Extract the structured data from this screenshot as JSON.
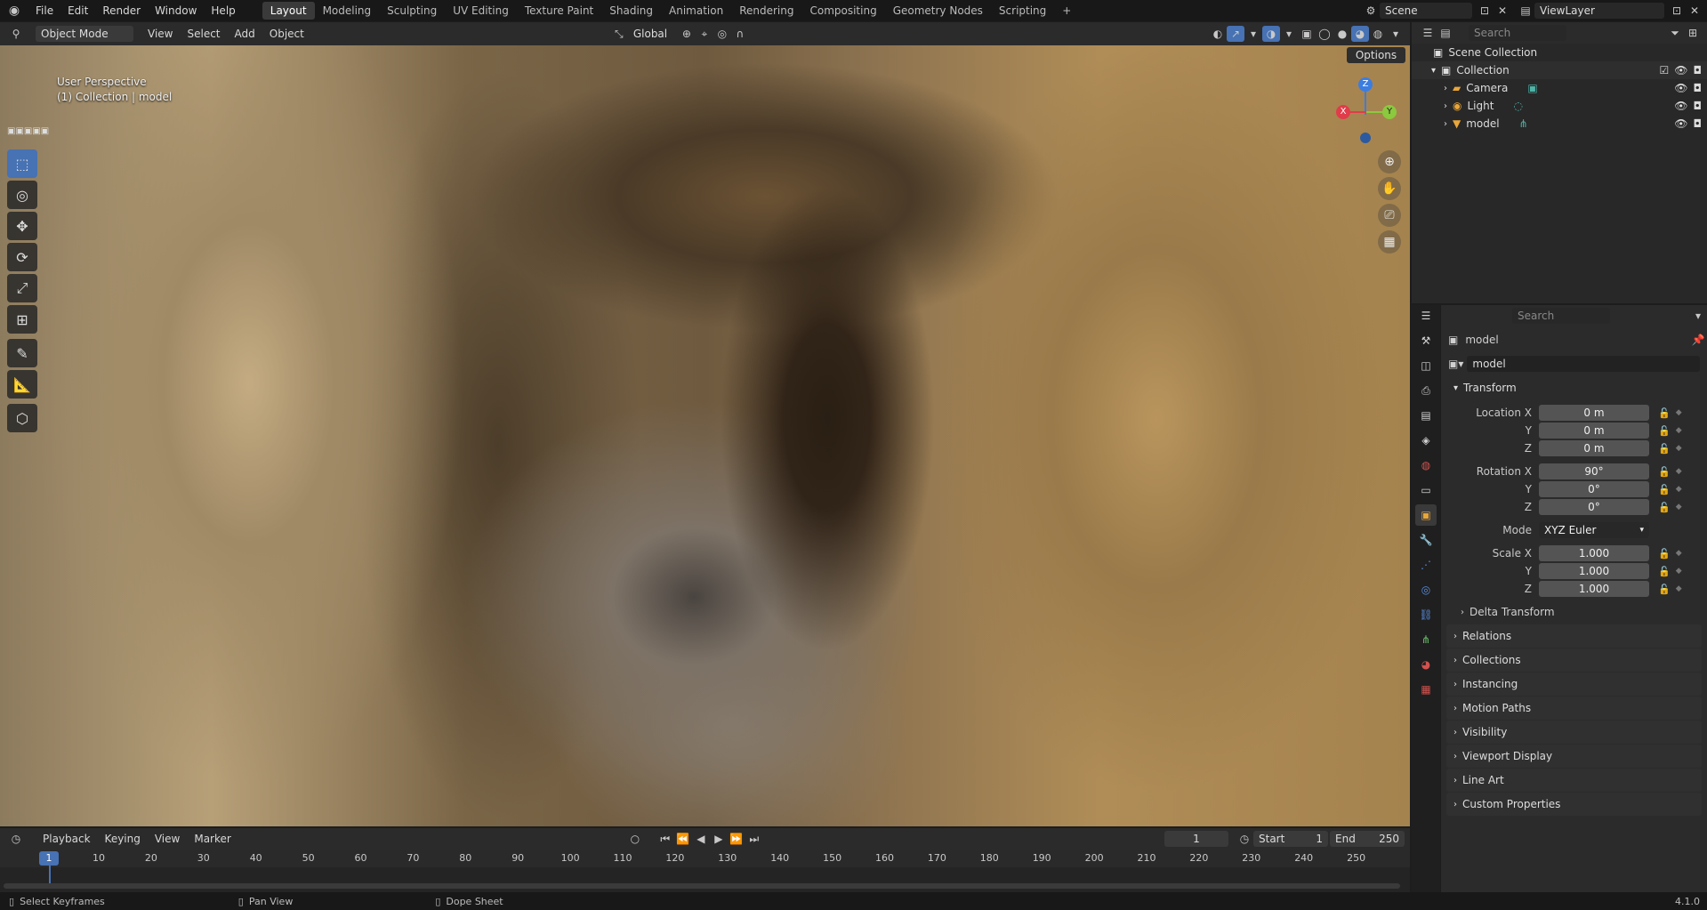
{
  "topbar": {
    "menus": [
      "File",
      "Edit",
      "Render",
      "Window",
      "Help"
    ],
    "workspace_tabs": [
      "Layout",
      "Modeling",
      "Sculpting",
      "UV Editing",
      "Texture Paint",
      "Shading",
      "Animation",
      "Rendering",
      "Compositing",
      "Geometry Nodes",
      "Scripting"
    ],
    "active_workspace": "Layout",
    "add_tab_label": "+",
    "scene_name": "Scene",
    "view_layer": "ViewLayer"
  },
  "viewport_header": {
    "mode": "Object Mode",
    "menus": [
      "View",
      "Select",
      "Add",
      "Object"
    ],
    "orientation": "Global",
    "options_label": "Options"
  },
  "viewport": {
    "perspective_label": "User Perspective",
    "collection_label": "(1) Collection | model",
    "gizmo": {
      "x": "X",
      "y": "Y",
      "z": "Z"
    }
  },
  "outliner": {
    "search_placeholder": "Search",
    "root": "Scene Collection",
    "collection": "Collection",
    "items": [
      "Camera",
      "Light",
      "model"
    ]
  },
  "properties": {
    "search_placeholder": "Search",
    "object_name": "model",
    "data_name": "model",
    "transform_title": "Transform",
    "location_label": "Location X",
    "location": [
      "0 m",
      "0 m",
      "0 m"
    ],
    "rotation_label": "Rotation X",
    "rotation": [
      "90°",
      "0°",
      "0°"
    ],
    "mode_label": "Mode",
    "mode_value": "XYZ Euler",
    "scale_label": "Scale X",
    "scale": [
      "1.000",
      "1.000",
      "1.000"
    ],
    "axis_y": "Y",
    "axis_z": "Z",
    "delta_transform": "Delta Transform",
    "panels": [
      "Relations",
      "Collections",
      "Instancing",
      "Motion Paths",
      "Visibility",
      "Viewport Display",
      "Line Art",
      "Custom Properties"
    ]
  },
  "timeline": {
    "menus": [
      "Playback",
      "Keying",
      "View",
      "Marker"
    ],
    "current_frame": "1",
    "start_label": "Start",
    "start_value": "1",
    "end_label": "End",
    "end_value": "250",
    "ruler_current": "1",
    "ruler": [
      "10",
      "20",
      "30",
      "40",
      "50",
      "60",
      "70",
      "80",
      "90",
      "100",
      "110",
      "120",
      "130",
      "140",
      "150",
      "160",
      "170",
      "180",
      "190",
      "200",
      "210",
      "220",
      "230",
      "240",
      "250"
    ]
  },
  "statusbar": {
    "hints": [
      "Select Keyframes",
      "Pan View",
      "Dope Sheet"
    ],
    "version": "4.1.0"
  },
  "colors": {
    "accent": "#4772b3",
    "gizmo_x": "#e03c4a",
    "gizmo_y": "#8bc93e",
    "gizmo_z": "#3b7de0"
  }
}
